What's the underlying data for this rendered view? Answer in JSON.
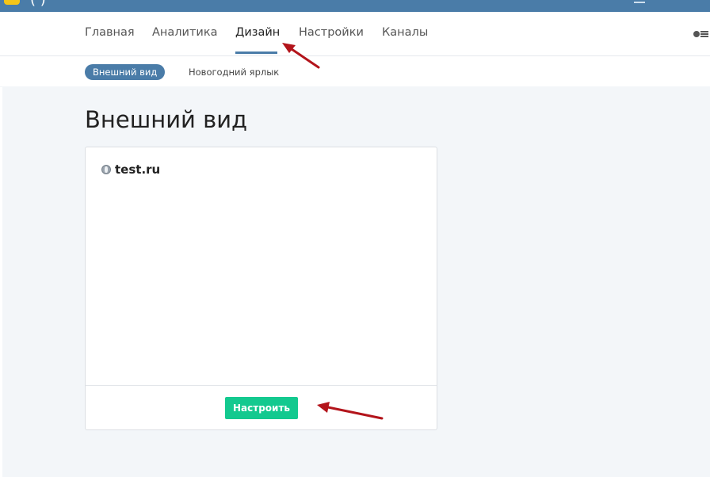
{
  "window": {
    "title_fragment": "(    )"
  },
  "nav": {
    "tabs": [
      {
        "label": "Главная"
      },
      {
        "label": "Аналитика"
      },
      {
        "label": "Дизайн"
      },
      {
        "label": "Настройки"
      },
      {
        "label": "Каналы"
      }
    ],
    "active_tab": "Дизайн"
  },
  "subnav": {
    "items": [
      {
        "label": "Внешний вид"
      },
      {
        "label": "Новогодний ярлык"
      }
    ],
    "active_item": "Внешний вид"
  },
  "main": {
    "title": "Внешний вид",
    "card": {
      "site_name": "test.ru",
      "configure_button": "Настроить"
    }
  },
  "colors": {
    "accent": "#4a7ca8",
    "button": "#13c98f",
    "annotation_arrow": "#b3141b"
  },
  "icons": [
    "globe-icon",
    "corner-icons"
  ]
}
